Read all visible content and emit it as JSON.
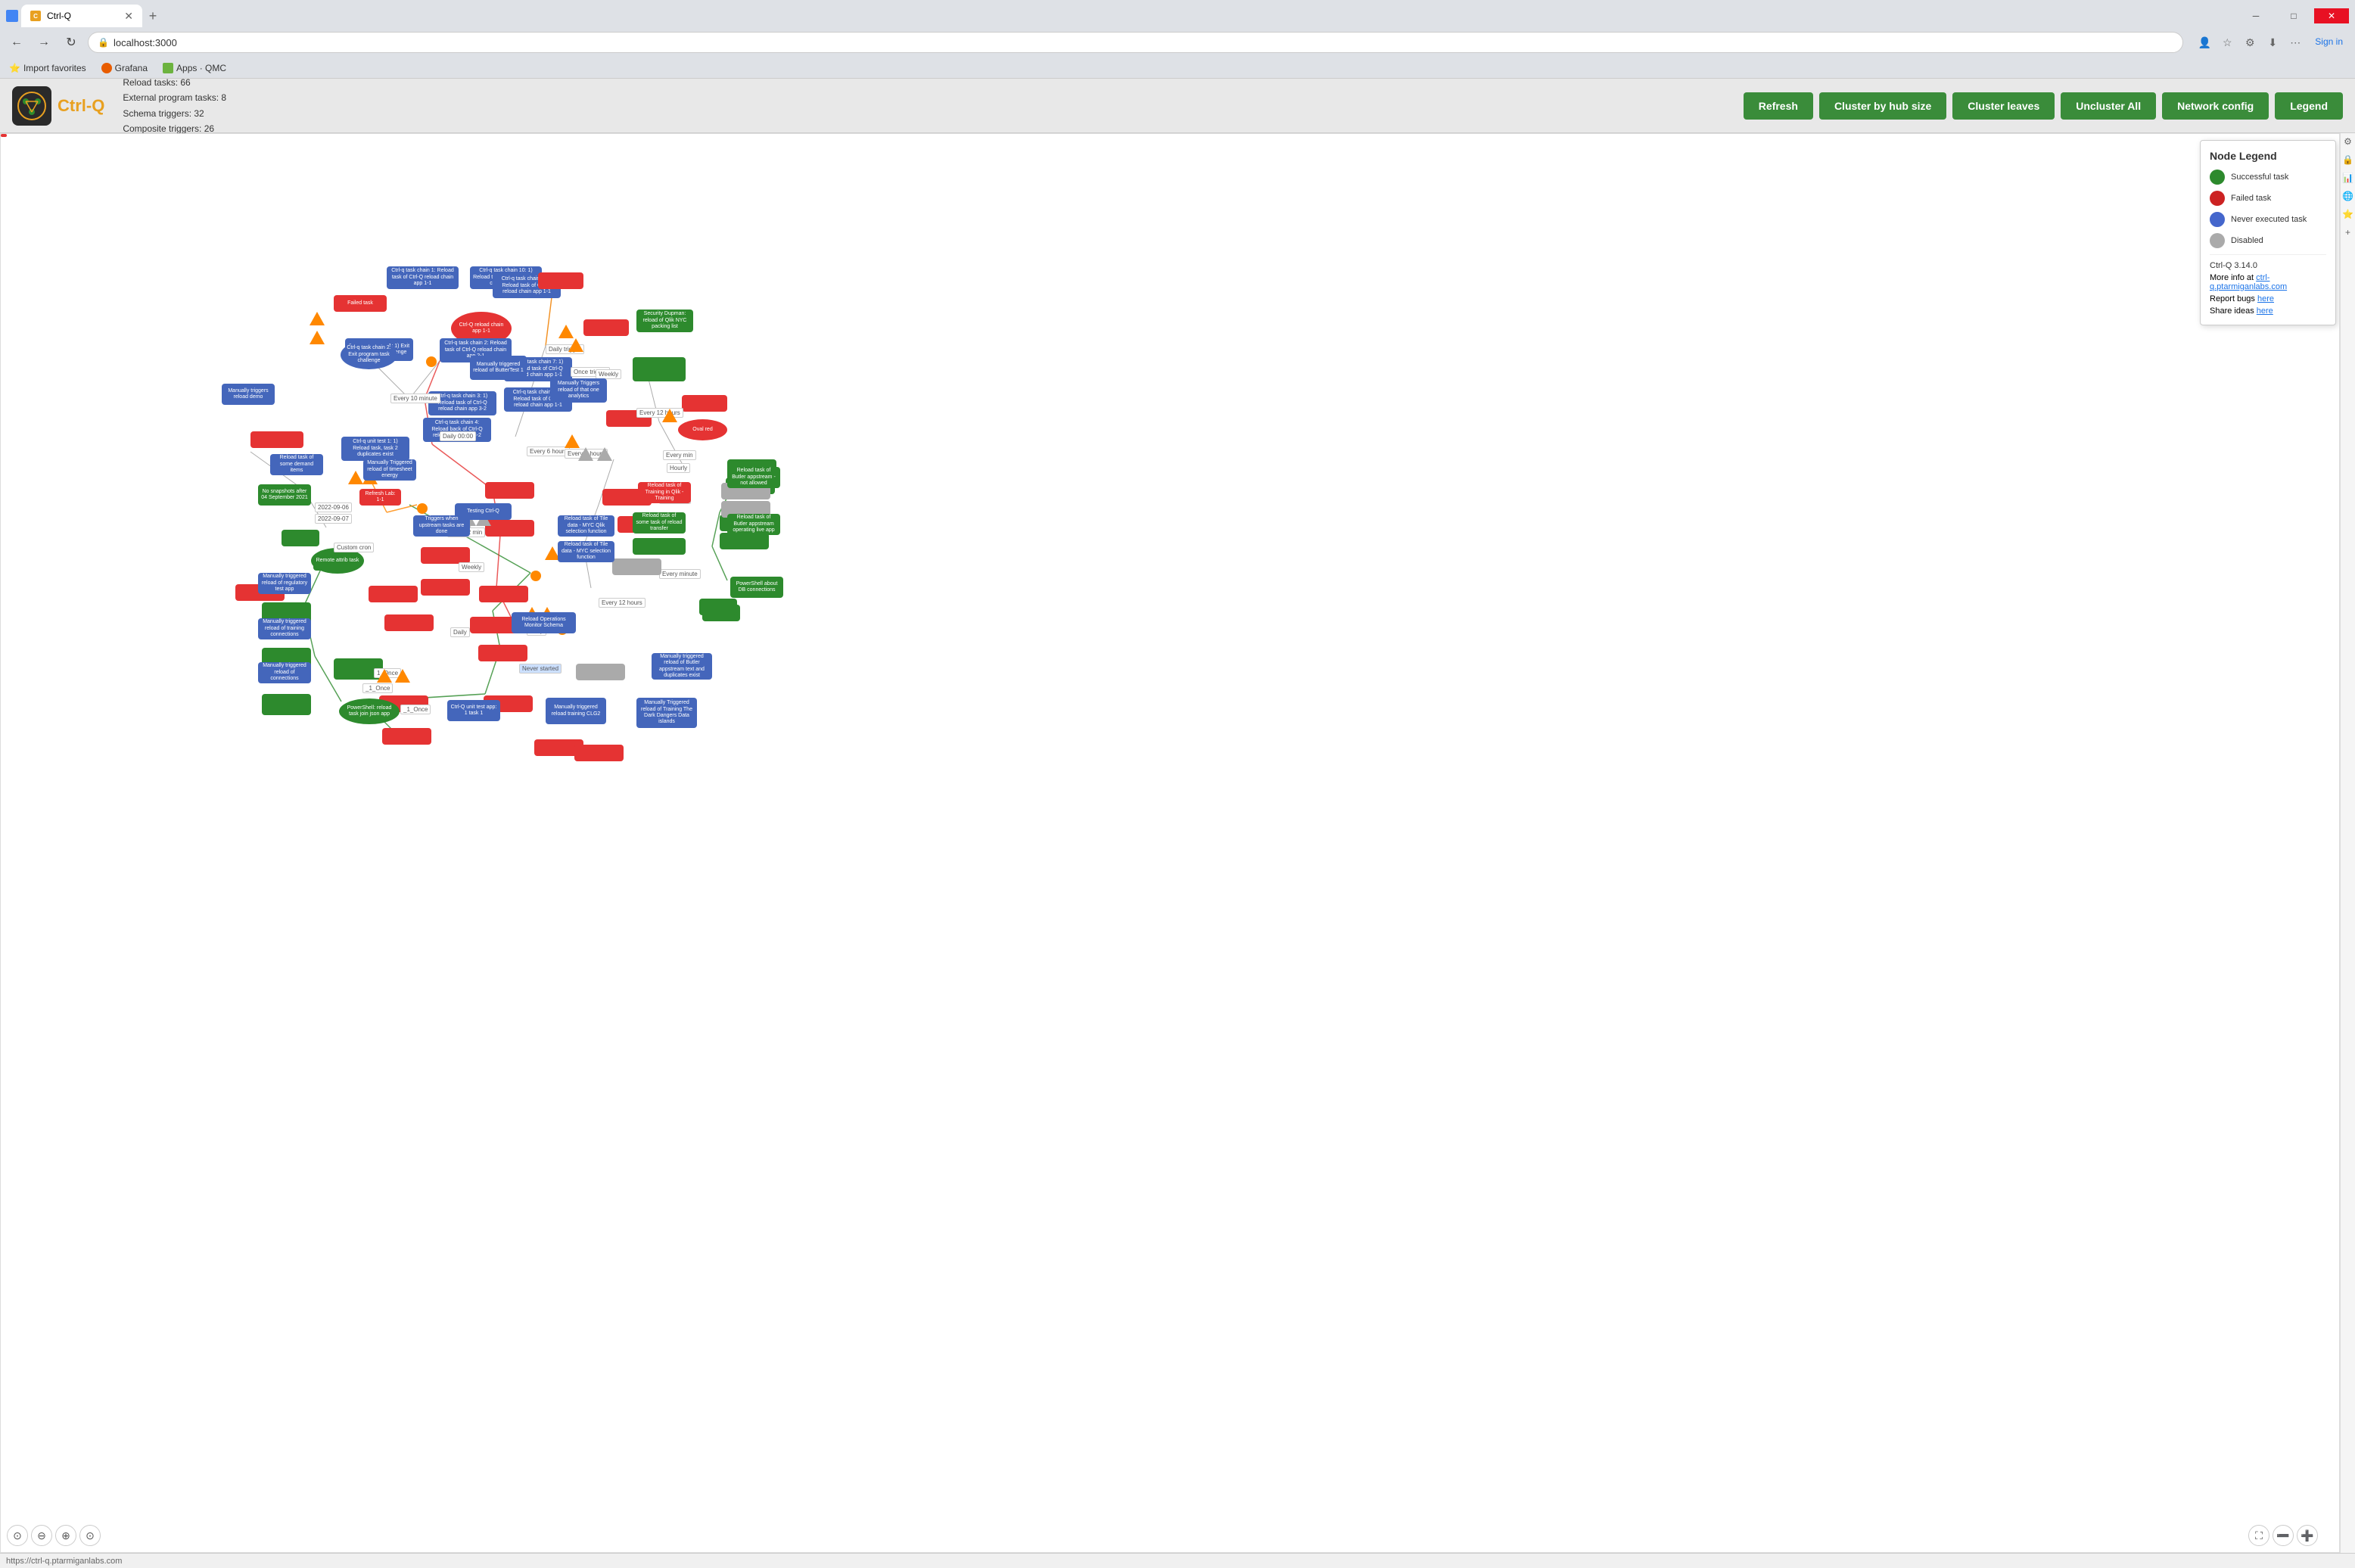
{
  "browser": {
    "tab_title": "Ctrl-Q",
    "url": "localhost:3000",
    "bookmarks": [
      {
        "label": "Import favorites",
        "icon": "⭐"
      },
      {
        "label": "Grafana",
        "icon": "🔴"
      },
      {
        "label": "Apps · QMC",
        "icon": "📊"
      }
    ],
    "window_title": "Ctrl-Q"
  },
  "header": {
    "logo_text": "Ctrl-Q",
    "stats": {
      "reload_tasks": "Reload tasks: 66",
      "external_program": "External program tasks: 8",
      "schema_triggers": "Schema triggers: 32",
      "composite_triggers": "Composite triggers: 26"
    },
    "buttons": {
      "refresh": "Refresh",
      "cluster_hub": "Cluster by hub size",
      "cluster_leaves": "Cluster leaves",
      "uncluster_all": "Uncluster All",
      "network_config": "Network config",
      "legend": "Legend"
    }
  },
  "legend": {
    "title": "Node Legend",
    "items": [
      {
        "label": "Successful task",
        "type": "success"
      },
      {
        "label": "Failed task",
        "type": "failed"
      },
      {
        "label": "Never executed task",
        "type": "never"
      },
      {
        "label": "Disabled",
        "type": "disabled"
      }
    ],
    "version": "Ctrl-Q 3.14.0",
    "more_info_text": "More info at ",
    "more_info_link": "ctrl-q.ptarmiganlabs.com",
    "report_bugs_text": "Report bugs ",
    "report_bugs_link": "here",
    "share_ideas_text": "Share ideas ",
    "share_ideas_link": "here"
  },
  "nodes": {
    "trigger_labels": [
      "Every 10 minute",
      "Daily 00:00",
      "Daily trigger",
      "Once trigger",
      "Weekly",
      "Hourly",
      "Every 6 hours",
      "Every 8 hours",
      "Every 12 hours",
      "Every min",
      "Daily",
      "Every 2 min",
      "Custom cron",
      "Weekly",
      "Every 12 hours",
      "Every minute",
      "1_Once",
      "_1_Once",
      "Hourly 11",
      "2022-09-06",
      "2022-09-07"
    ],
    "special_labels": [
      "Manually triggered reload of Training The Dark Dangers Data islands",
      "Reload Operations Monitor Schema",
      "Testing Ctrl-Q",
      "Never started"
    ]
  },
  "status_bar": {
    "url": "https://ctrl-q.ptarmiganlabs.com"
  },
  "colors": {
    "green": "#2d8a2d",
    "red": "#e53333",
    "blue": "#4466bb",
    "gray": "#aaaaaa",
    "orange": "#ff8800",
    "toolbar_green": "#3a8c3a"
  }
}
